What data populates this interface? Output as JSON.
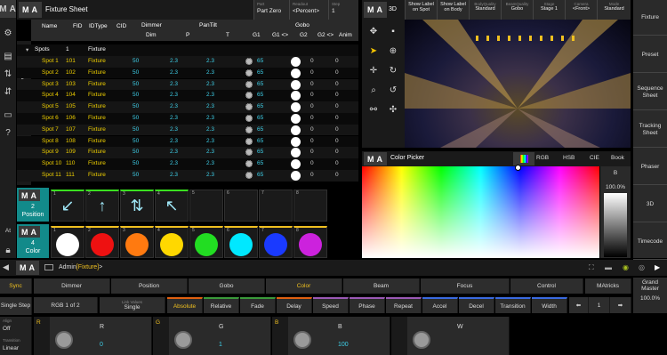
{
  "fixture_sheet": {
    "title": "Fixture Sheet",
    "top_buttons": [
      {
        "k": "Part",
        "v": "Part Zero"
      },
      {
        "k": "Readout",
        "v": "<Percent>"
      },
      {
        "k": "Step",
        "v": "1"
      }
    ],
    "headers": {
      "name": "Name",
      "fid": "FID",
      "idtype": "IDType",
      "cid": "CID",
      "dimmer": "Dimmer",
      "pantilt": "PanTilt",
      "gobo": "Gobo",
      "dim": "Dim",
      "p": "P",
      "t": "T",
      "g1": "G1",
      "g1x": "G1 <>",
      "g2": "G2",
      "g2x": "G2 <>",
      "anim": "Anim"
    },
    "group_row": {
      "name": "Spots",
      "fid": "1",
      "idtype": "Fixture"
    },
    "rows": [
      {
        "name": "Spot 1",
        "fid": "101",
        "type": "Fixture",
        "dim": "50",
        "p": "2.3",
        "t": "2.3",
        "g1x": "65",
        "g2x": "0",
        "anim": "0"
      },
      {
        "name": "Spot 2",
        "fid": "102",
        "type": "Fixture",
        "dim": "50",
        "p": "2.3",
        "t": "2.3",
        "g1x": "65",
        "g2x": "0",
        "anim": "0"
      },
      {
        "name": "Spot 3",
        "fid": "103",
        "type": "Fixture",
        "dim": "50",
        "p": "2.3",
        "t": "2.3",
        "g1x": "65",
        "g2x": "0",
        "anim": "0"
      },
      {
        "name": "Spot 4",
        "fid": "104",
        "type": "Fixture",
        "dim": "50",
        "p": "2.3",
        "t": "2.3",
        "g1x": "65",
        "g2x": "0",
        "anim": "0"
      },
      {
        "name": "Spot 5",
        "fid": "105",
        "type": "Fixture",
        "dim": "50",
        "p": "2.3",
        "t": "2.3",
        "g1x": "65",
        "g2x": "0",
        "anim": "0"
      },
      {
        "name": "Spot 6",
        "fid": "106",
        "type": "Fixture",
        "dim": "50",
        "p": "2.3",
        "t": "2.3",
        "g1x": "65",
        "g2x": "0",
        "anim": "0"
      },
      {
        "name": "Spot 7",
        "fid": "107",
        "type": "Fixture",
        "dim": "50",
        "p": "2.3",
        "t": "2.3",
        "g1x": "65",
        "g2x": "0",
        "anim": "0"
      },
      {
        "name": "Spot 8",
        "fid": "108",
        "type": "Fixture",
        "dim": "50",
        "p": "2.3",
        "t": "2.3",
        "g1x": "65",
        "g2x": "0",
        "anim": "0"
      },
      {
        "name": "Spot 9",
        "fid": "109",
        "type": "Fixture",
        "dim": "50",
        "p": "2.3",
        "t": "2.3",
        "g1x": "65",
        "g2x": "0",
        "anim": "0"
      },
      {
        "name": "Spot 10",
        "fid": "110",
        "type": "Fixture",
        "dim": "50",
        "p": "2.3",
        "t": "2.3",
        "g1x": "65",
        "g2x": "0",
        "anim": "0"
      },
      {
        "name": "Spot 11",
        "fid": "111",
        "type": "Fixture",
        "dim": "50",
        "p": "2.3",
        "t": "2.3",
        "g1x": "65",
        "g2x": "0",
        "anim": "0"
      }
    ]
  },
  "viewer3d": {
    "tab": "3D",
    "buttons": [
      {
        "k": "",
        "v": "Show Label on Spot"
      },
      {
        "k": "",
        "v": "Show Label on Body"
      },
      {
        "k": "BodyQuality",
        "v": "Standard"
      },
      {
        "k": "BeamQuality",
        "v": "Gobo"
      },
      {
        "k": "Stage",
        "v": "Stage 1"
      },
      {
        "k": "Camera",
        "v": "<Front>"
      },
      {
        "k": "Mode",
        "v": "Standard"
      }
    ]
  },
  "color_picker": {
    "title": "Color Picker",
    "tabs": [
      "RGB",
      "HSB",
      "CIE",
      "Book"
    ],
    "b_label": "B",
    "b_value": "100.0%"
  },
  "presets": {
    "position": {
      "label": "2\nPosition",
      "count_label": "2",
      "name": "Position",
      "slots": [
        "1",
        "2",
        "3",
        "4",
        "5",
        "6",
        "7",
        "8"
      ]
    },
    "color": {
      "count_label": "4",
      "name": "Color",
      "slots": [
        "1",
        "2",
        "3",
        "4",
        "5",
        "6",
        "7",
        "8"
      ],
      "colors": [
        "#ffffff",
        "#ee1111",
        "#ff7a10",
        "#ffd800",
        "#22dd22",
        "#00e8ff",
        "#1a3aff",
        "#cc22dd"
      ]
    }
  },
  "right_column": [
    "Fixture",
    "Preset",
    "Sequence Sheet",
    "Tracking Sheet",
    "Phaser",
    "3D",
    "Timecode"
  ],
  "left_column_at": "At",
  "command_line": {
    "prefix": "Admin",
    "context": "[Fixture]",
    "suffix": ">"
  },
  "feature_bar": {
    "sync": "Sync",
    "features": [
      "Dimmer",
      "Position",
      "Gobo",
      "Color",
      "Beam",
      "Focus",
      "Control"
    ],
    "matricks": "MAtricks",
    "grand_master": "Grand Master",
    "grand_master_value": "100.0%"
  },
  "step_bar": {
    "single_step": "Single Step",
    "rgb": "RGB 1 of 2",
    "link_values_label": "Link Values",
    "link_values": "Single",
    "modes": [
      "Absolute",
      "Relative",
      "Fade",
      "Delay",
      "Speed",
      "Phase",
      "Repeat",
      "Accel",
      "Decel",
      "Transition",
      "Width"
    ],
    "page": "1"
  },
  "encoder_bar": {
    "align_label": "Align",
    "align": "Off",
    "transition_label": "Transition",
    "transition": "Linear",
    "encoders": [
      {
        "tag": "R",
        "name": "R",
        "value": "0"
      },
      {
        "tag": "G",
        "name": "G",
        "value": "1"
      },
      {
        "tag": "B",
        "name": "B",
        "value": "100"
      },
      {
        "tag": "",
        "name": "W",
        "value": ""
      }
    ]
  }
}
